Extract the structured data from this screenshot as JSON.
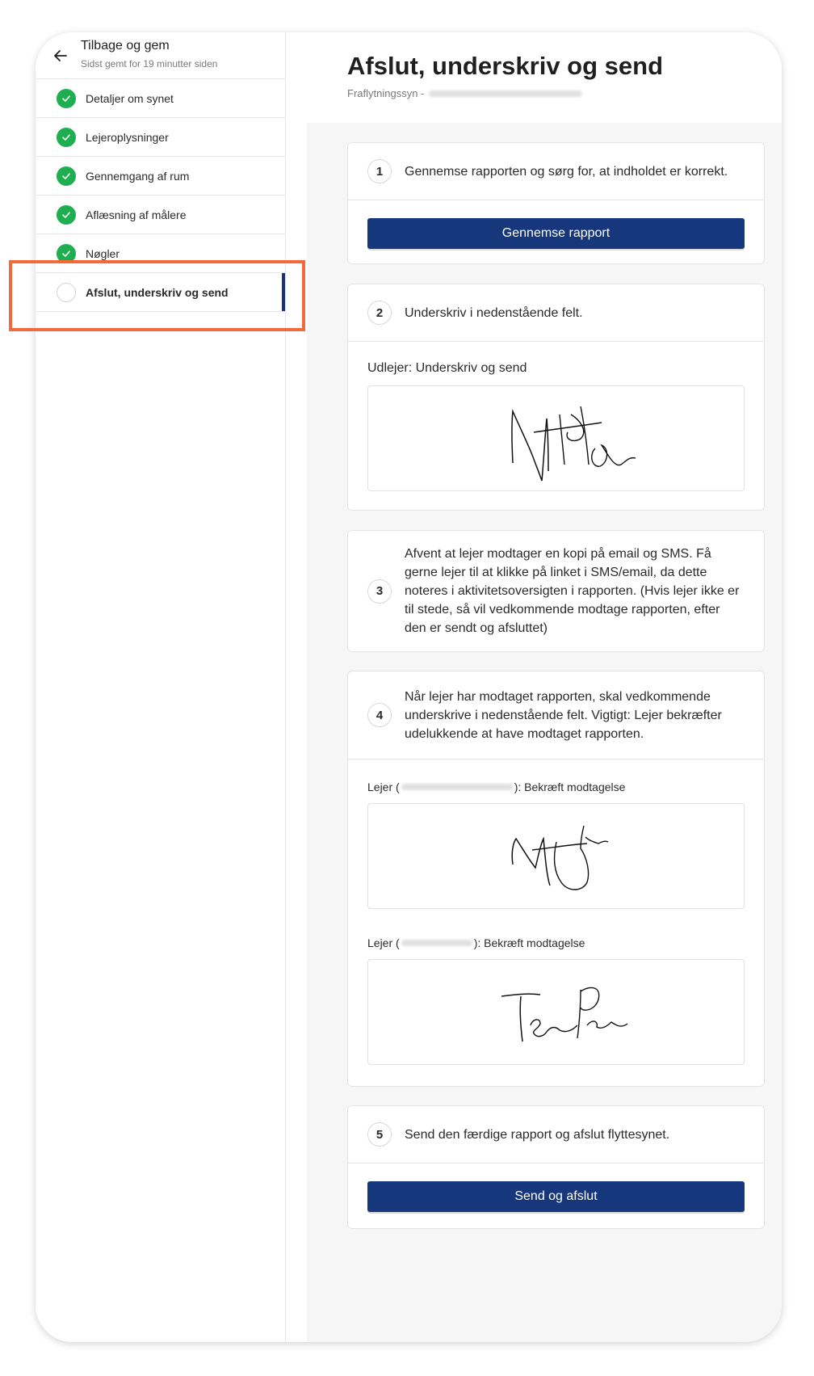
{
  "sidebar": {
    "back_title": "Tilbage og gem",
    "back_sub": "Sidst gemt for 19 minutter siden",
    "items": [
      {
        "label": "Detaljer om synet",
        "done": true
      },
      {
        "label": "Lejeroplysninger",
        "done": true
      },
      {
        "label": "Gennemgang af rum",
        "done": true
      },
      {
        "label": "Aflæsning af målere",
        "done": true
      },
      {
        "label": "Nøgler",
        "done": true
      },
      {
        "label": "Afslut, underskriv og send",
        "done": false,
        "active": true
      }
    ]
  },
  "header": {
    "title": "Afslut, underskriv og send",
    "subtitle_prefix": "Fraflytningssyn -"
  },
  "steps": {
    "s1": {
      "num": "1",
      "text": "Gennemse rapporten og sørg for, at indholdet er korrekt.",
      "button": "Gennemse rapport"
    },
    "s2": {
      "num": "2",
      "text": "Underskriv i nedenstående felt.",
      "field_label": "Udlejer: Underskriv og send"
    },
    "s3": {
      "num": "3",
      "text": "Afvent at lejer modtager en kopi på email og SMS. Få gerne lejer til at klikke på linket i SMS/email, da dette noteres i aktivitetsoversigten i rapporten. (Hvis lejer ikke er til stede, så vil vedkommende modtage rapporten, efter den er sendt og afsluttet)"
    },
    "s4": {
      "num": "4",
      "text": "Når lejer har modtaget rapporten, skal vedkommende underskrive i nedenstående felt. Vigtigt: Lejer bekræfter udelukkende at have modtaget rapporten.",
      "lejer_prefix": "Lejer (",
      "lejer_suffix": "): Bekræft modtagelse"
    },
    "s5": {
      "num": "5",
      "text": "Send den færdige rapport og afslut flyttesynet.",
      "button": "Send og afslut"
    }
  },
  "colors": {
    "primary": "#17377c",
    "success": "#1fae4f",
    "highlight": "#f26a3a"
  }
}
